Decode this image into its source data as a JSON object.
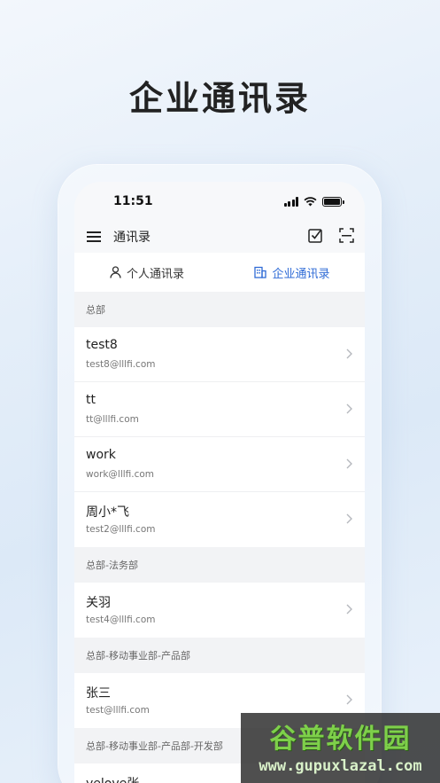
{
  "hero_title": "企业通讯录",
  "status": {
    "time": "11:51"
  },
  "nav": {
    "title": "通讯录"
  },
  "tabs": [
    {
      "label": "个人通讯录",
      "active": false
    },
    {
      "label": "企业通讯录",
      "active": true
    }
  ],
  "groups": [
    {
      "name": "总部",
      "contacts": [
        {
          "name": "test8",
          "email": "test8@lllfi.com"
        },
        {
          "name": "tt",
          "email": "tt@lllfi.com"
        },
        {
          "name": "work",
          "email": "work@lllfi.com"
        },
        {
          "name": "周小*飞",
          "email": "test2@lllfi.com"
        }
      ]
    },
    {
      "name": "总部-法务部",
      "contacts": [
        {
          "name": "关羽",
          "email": "test4@lllfi.com"
        }
      ]
    },
    {
      "name": "总部-移动事业部-产品部",
      "contacts": [
        {
          "name": "张三",
          "email": "test@lllfi.com"
        }
      ]
    },
    {
      "name": "总部-移动事业部-产品部-开发部",
      "contacts": [
        {
          "name": "yelove张",
          "email": ""
        }
      ]
    }
  ],
  "watermark": {
    "title": "谷普软件园",
    "url": "www.gupuxlazal.com"
  },
  "colors": {
    "accent": "#2f6bd6",
    "background": "#f5f6f8",
    "watermark_green": "#7ed04a"
  },
  "icons": {
    "menu": "menu-icon",
    "check": "checkbox-icon",
    "scan": "scan-icon",
    "person": "person-icon",
    "building": "building-icon",
    "chevron": "chevron-right-icon"
  }
}
